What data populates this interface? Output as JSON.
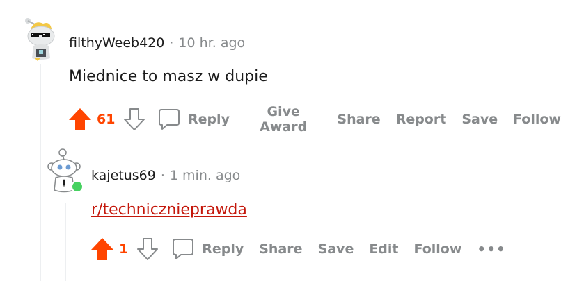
{
  "comment": {
    "username": "filthyWeeb420",
    "separator": "·",
    "timestamp": "10 hr. ago",
    "body": "Miednice to masz w dupie",
    "votes": "61",
    "actions": {
      "reply": "Reply",
      "give_award": "Give Award",
      "share": "Share",
      "report": "Report",
      "save": "Save",
      "follow": "Follow"
    }
  },
  "reply": {
    "username": "kajetus69",
    "separator": "·",
    "timestamp": "1 min. ago",
    "link": "r/technicznieprawda",
    "votes": "1",
    "actions": {
      "reply": "Reply",
      "share": "Share",
      "save": "Save",
      "edit": "Edit",
      "follow": "Follow",
      "more": "•••"
    }
  },
  "colors": {
    "upvote": "#ff4500",
    "muted": "#878a8c",
    "link": "#c4170b",
    "online": "#46d160",
    "thread_line": "#edeff1"
  },
  "icons": [
    "upvote-arrow-icon",
    "downvote-arrow-icon",
    "comment-bubble-icon",
    "snoo-avatar-icon",
    "sunglasses-icon",
    "online-indicator-icon",
    "more-dots-icon"
  ]
}
